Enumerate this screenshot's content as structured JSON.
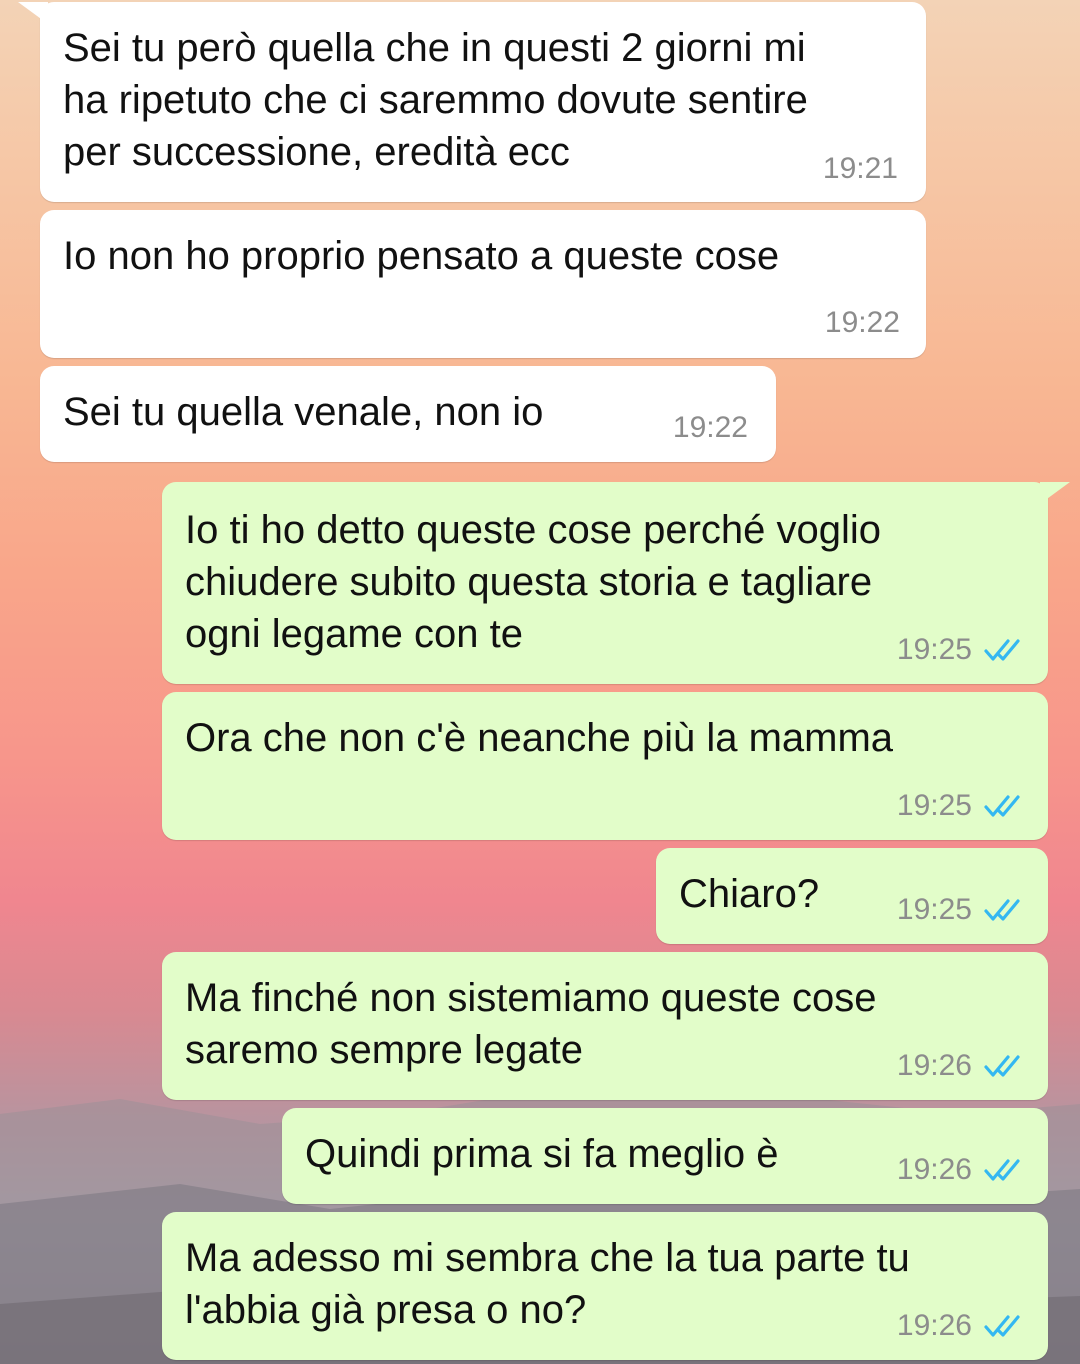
{
  "colors": {
    "incoming_bubble": "#ffffff",
    "outgoing_bubble": "#e2fdc9",
    "time_text": "#8c8c8c",
    "read_ticks": "#34b7f1"
  },
  "messages": [
    {
      "direction": "incoming",
      "text": "Sei tu però quella che in questi 2 giorni mi\nha ripetuto che ci saremmo dovute sentire\nper successione, eredità ecc",
      "time": "19:21"
    },
    {
      "direction": "incoming",
      "text": "Io non ho proprio pensato a queste cose",
      "time": "19:22"
    },
    {
      "direction": "incoming",
      "text": "Sei tu quella venale, non io",
      "time": "19:22"
    },
    {
      "direction": "outgoing",
      "text": "Io ti ho detto queste cose perché voglio\nchiudere subito questa storia e tagliare\nogni legame con te",
      "time": "19:25",
      "status_icon": "double-check-read-icon"
    },
    {
      "direction": "outgoing",
      "text": "Ora che non c'è neanche più la mamma",
      "time": "19:25",
      "status_icon": "double-check-read-icon"
    },
    {
      "direction": "outgoing",
      "text": "Chiaro?",
      "time": "19:25",
      "status_icon": "double-check-read-icon"
    },
    {
      "direction": "outgoing",
      "text": "Ma finché non sistemiamo queste cose\nsaremo sempre legate",
      "time": "19:26",
      "status_icon": "double-check-read-icon"
    },
    {
      "direction": "outgoing",
      "text": "Quindi prima si fa meglio è",
      "time": "19:26",
      "status_icon": "double-check-read-icon"
    },
    {
      "direction": "outgoing",
      "text": "Ma adesso mi sembra che la tua parte tu\nl'abbia già presa o no?",
      "time": "19:26",
      "status_icon": "double-check-read-icon"
    }
  ]
}
